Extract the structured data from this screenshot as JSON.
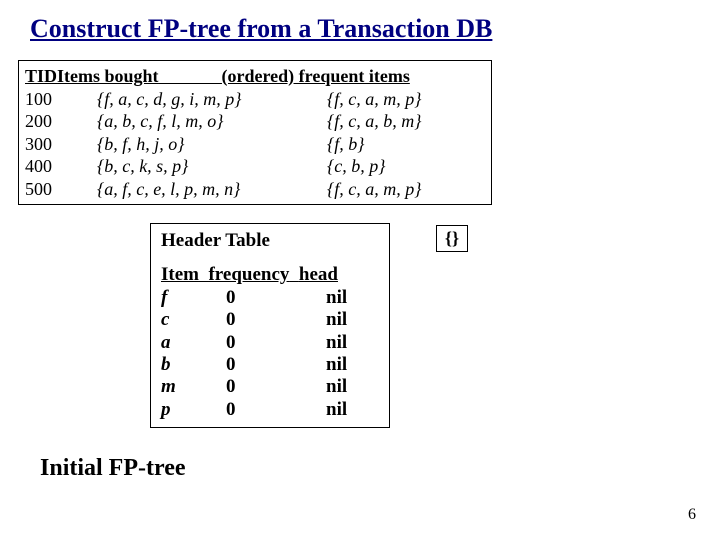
{
  "title": "Construct FP-tree from a Transaction DB",
  "trans_header": {
    "tid": "TID",
    "items": "Items bought",
    "freq": "(ordered) frequent items"
  },
  "transactions": [
    {
      "tid": "100",
      "items": "{f, a, c, d, g, i, m, p}",
      "freq": "{f, c, a, m, p}"
    },
    {
      "tid": "200",
      "items": "{a, b, c, f, l, m, o}",
      "freq": "{f, c, a, b, m}"
    },
    {
      "tid": "300",
      "items": "{b, f, h, j, o}",
      "freq": "{f, b}"
    },
    {
      "tid": "400",
      "items": "{b, c, k, s, p}",
      "freq": "{c, b, p}"
    },
    {
      "tid": "500",
      "items": "{a, f, c, e, l, p, m, n}",
      "freq": "{f, c, a, m, p}"
    }
  ],
  "header_table": {
    "title": "Header Table",
    "columns": {
      "item": "Item",
      "freq": "frequency",
      "head": "head"
    },
    "rows": [
      {
        "item": " f",
        "freq": "0",
        "head": "nil"
      },
      {
        "item": "c",
        "freq": "0",
        "head": "nil"
      },
      {
        "item": "a",
        "freq": "0",
        "head": "nil"
      },
      {
        "item": "b",
        "freq": "0",
        "head": "nil"
      },
      {
        "item": "m",
        "freq": "0",
        "head": "nil"
      },
      {
        "item": "p",
        "freq": "0",
        "head": "nil"
      }
    ]
  },
  "root_label": "{}",
  "subtitle": "Initial FP-tree",
  "page_number": "6"
}
